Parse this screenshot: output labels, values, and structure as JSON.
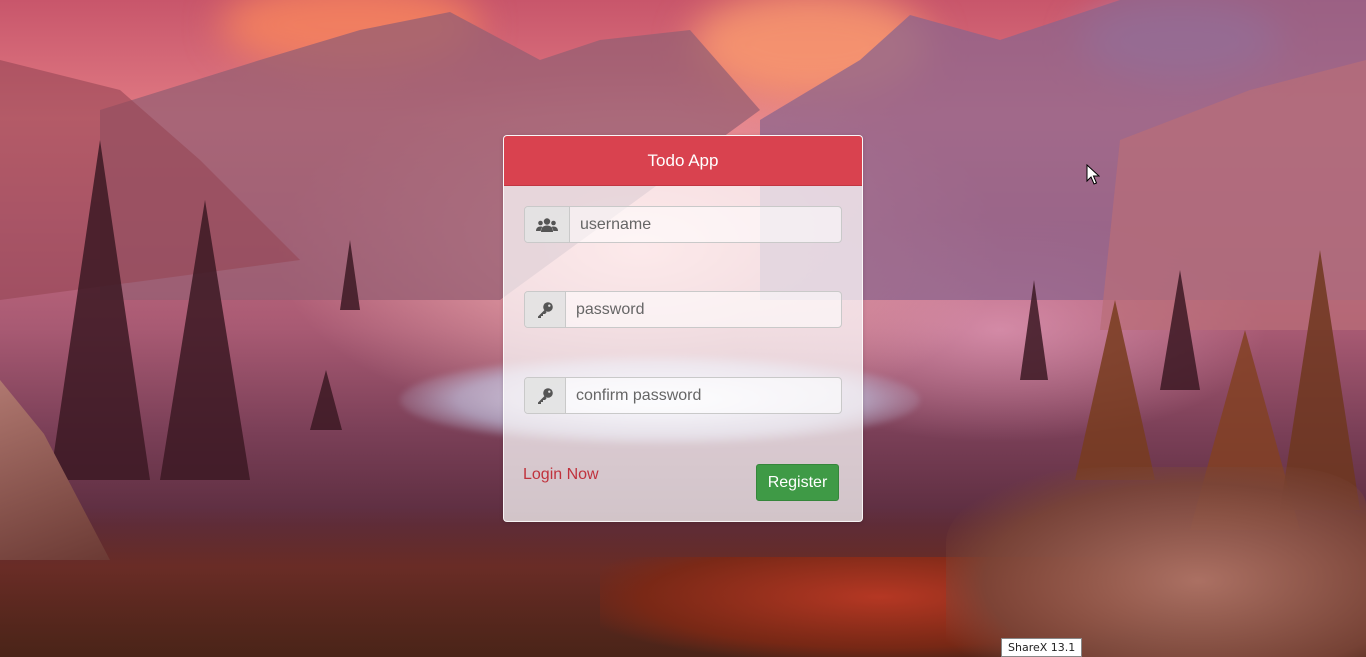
{
  "app": {
    "title": "Todo App"
  },
  "form": {
    "username": {
      "value": "",
      "placeholder": "username",
      "icon": "users-icon"
    },
    "password": {
      "value": "",
      "placeholder": "password",
      "icon": "key-icon"
    },
    "confirm_password": {
      "value": "",
      "placeholder": "confirm password",
      "icon": "key-icon"
    }
  },
  "actions": {
    "login_label": "Login Now",
    "register_label": "Register"
  },
  "overlay": {
    "sharex_label": "ShareX 13.1"
  },
  "colors": {
    "header_bg": "#d9424f",
    "register_bg": "#3f9a46",
    "link": "#c0323d"
  }
}
